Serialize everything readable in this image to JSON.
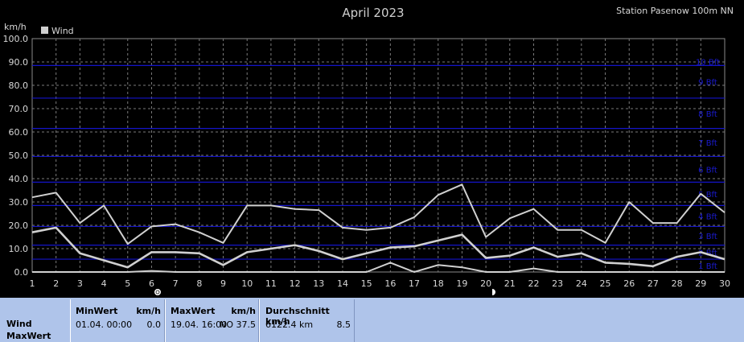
{
  "title": "April 2023",
  "station": "Station Pasenow 100m NN",
  "y_unit": "km/h",
  "legend": {
    "label": "Wind",
    "swatch_color": "#d0d0d0"
  },
  "beaufort_labels": [
    "1 Bft",
    "2 Bft",
    "3 Bft",
    "4 Bft",
    "5 Bft",
    "6 Bft",
    "7 Bft",
    "8 Bft",
    "9 Bft",
    "10 Bft"
  ],
  "chart_data": {
    "type": "line",
    "title": "April 2023",
    "ylabel": "km/h",
    "xlabel": "",
    "x": [
      1,
      2,
      3,
      4,
      5,
      6,
      7,
      8,
      9,
      10,
      11,
      12,
      13,
      14,
      15,
      16,
      17,
      18,
      19,
      20,
      21,
      22,
      23,
      24,
      25,
      26,
      27,
      28,
      29,
      30
    ],
    "x_ticks": [
      "1",
      "2",
      "3",
      "4",
      "5",
      "6",
      "7",
      "8",
      "9",
      "10",
      "11",
      "12",
      "13",
      "14",
      "15",
      "16",
      "17",
      "18",
      "19",
      "20",
      "21",
      "22",
      "23",
      "24",
      "25",
      "26",
      "27",
      "28",
      "29",
      "30"
    ],
    "y_ticks": [
      "0.0",
      "10.0",
      "20.0",
      "30.0",
      "40.0",
      "50.0",
      "60.0",
      "70.0",
      "80.0",
      "90.0",
      "100.0"
    ],
    "ylim": [
      0,
      100
    ],
    "grid": true,
    "legend_position": "top-left",
    "beaufort_thresholds": [
      5.5,
      11.5,
      19.5,
      28.5,
      38.5,
      49.5,
      61.5,
      74.5,
      88.5
    ],
    "series": [
      {
        "name": "Wind",
        "role": "max",
        "color": "#d0d0d0",
        "values": [
          32,
          34,
          21,
          28.5,
          12,
          19.5,
          20.5,
          17,
          12.5,
          28.5,
          28.5,
          27,
          26.5,
          19,
          18,
          19,
          23.5,
          33,
          37.5,
          15,
          23,
          27,
          18,
          18,
          12.5,
          30,
          21,
          21,
          33.5,
          25.5
        ]
      },
      {
        "name": "Wind",
        "role": "average",
        "color": "#d0d0d0",
        "values": [
          17,
          19,
          8,
          5,
          2,
          8.5,
          8.5,
          8,
          3,
          8.5,
          10,
          11.5,
          9,
          5.5,
          8,
          10.5,
          11,
          13.5,
          16,
          6,
          7,
          10.5,
          6.5,
          8,
          4,
          3.5,
          2.5,
          6.5,
          8.5,
          5.5
        ]
      },
      {
        "name": "Wind",
        "role": "min",
        "color": "#d0d0d0",
        "values": [
          0,
          0,
          0,
          0,
          0,
          0.5,
          0,
          0,
          0,
          0,
          0,
          0,
          0,
          0,
          0,
          4,
          0,
          3,
          2,
          0,
          0,
          1.5,
          0,
          0,
          0,
          0,
          0,
          0,
          0,
          0
        ]
      }
    ]
  },
  "stats": {
    "row_label_1": "Wind",
    "row_label_2": "MaxWert",
    "min": {
      "header": "MinWert",
      "unit": "km/h",
      "date": "01.04.  00:00",
      "value": "0.0"
    },
    "max": {
      "header": "MaxWert",
      "unit": "km/h",
      "date": "19.04.  16:00",
      "dir_value": "NO 37.5"
    },
    "avg": {
      "header": "Durchschnitt km/h",
      "distance": "6122.4 km",
      "value": "8.5"
    }
  }
}
